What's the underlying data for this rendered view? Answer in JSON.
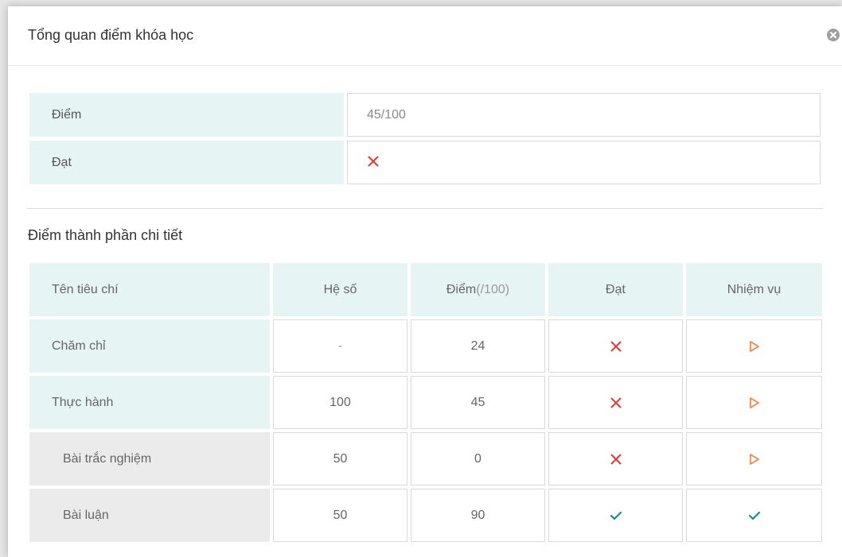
{
  "modal": {
    "title": "Tổng quan điểm khóa học"
  },
  "summary": {
    "score_label": "Điểm",
    "score_value": "45/100",
    "pass_label": "Đạt",
    "pass_status": "fail"
  },
  "details": {
    "section_title": "Điểm thành phần chi tiết",
    "columns": {
      "criteria": "Tên tiêu chí",
      "weight": "Hệ số",
      "score_main": "Điểm",
      "score_unit": "(/100)",
      "pass": "Đạt",
      "task": "Nhiệm vụ"
    },
    "rows": [
      {
        "name": "Chăm chỉ",
        "weight": "-",
        "score": "24",
        "pass": "fail",
        "task": "play"
      },
      {
        "name": "Thực hành",
        "weight": "100",
        "score": "45",
        "pass": "fail",
        "task": "play"
      },
      {
        "name": "Bài trắc nghiệm",
        "weight": "50",
        "score": "0",
        "pass": "fail",
        "task": "play"
      },
      {
        "name": "Bài luận",
        "weight": "50",
        "score": "90",
        "pass": "pass",
        "task": "check"
      }
    ]
  },
  "colors": {
    "fail_red": "#e53935",
    "task_orange": "#f0884b",
    "pass_teal": "#1a8a8a",
    "header_bg": "#e7f4f4",
    "sub_row_bg": "#ebebeb"
  }
}
